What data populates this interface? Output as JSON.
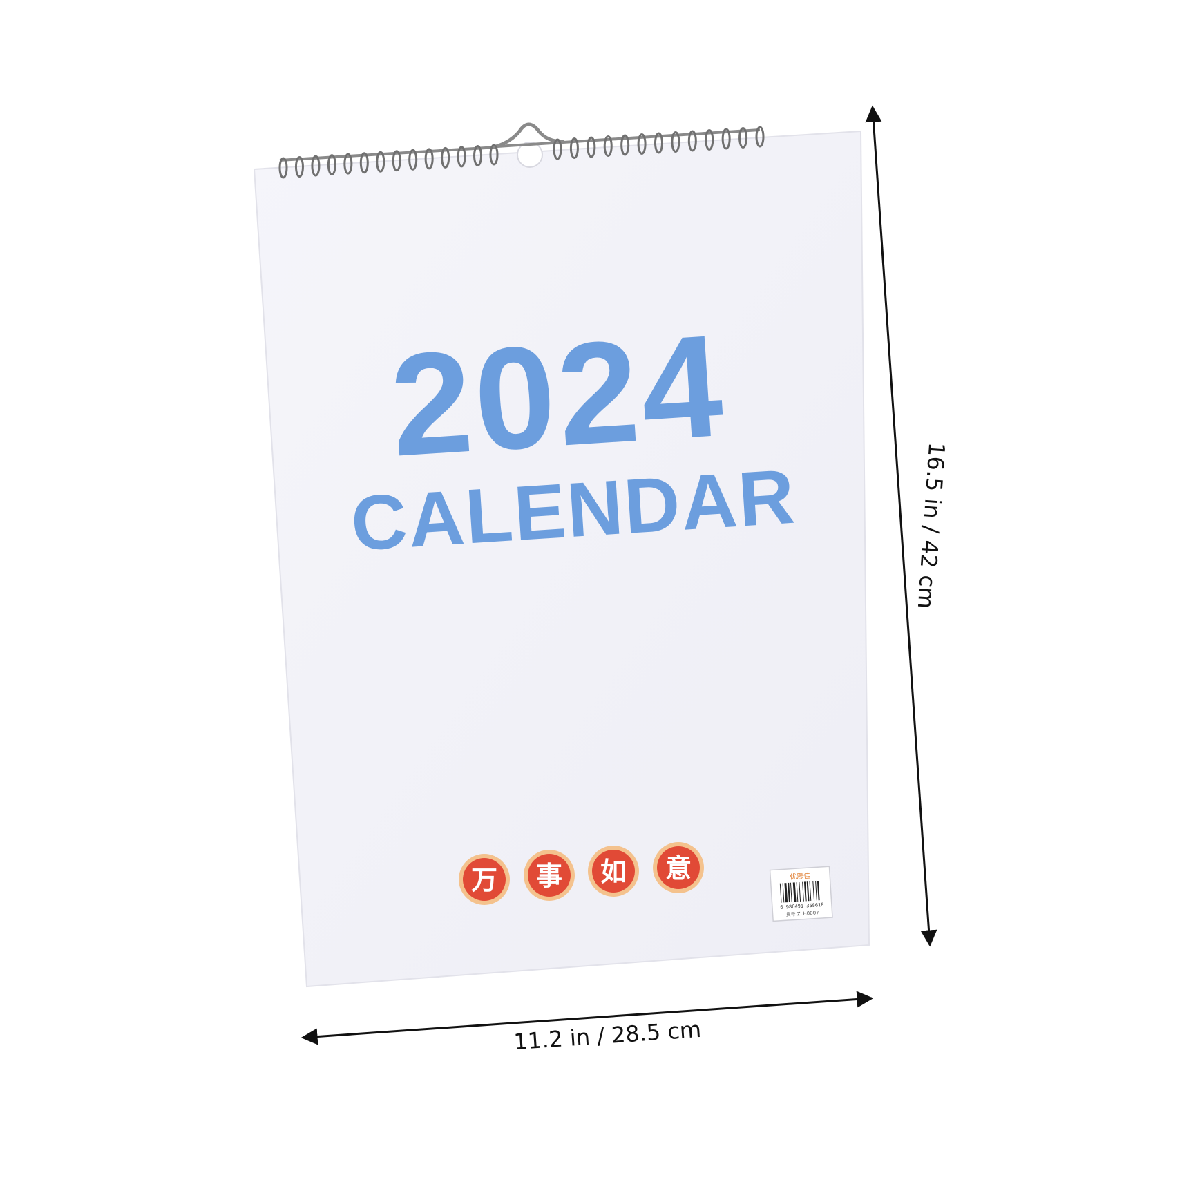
{
  "calendar": {
    "year": "2024",
    "word": "CALENDAR",
    "blessing_chars": [
      "万",
      "事",
      "如",
      "意"
    ],
    "barcode_brand": "优思佳",
    "barcode_number": "6 986491 358618",
    "barcode_sku": "货号 ZLH0007"
  },
  "dimensions": {
    "width_label": "11.2 in / 28.5 cm",
    "height_label": "16.5 in / 42 cm"
  },
  "colors": {
    "title_blue": "#6c9ede",
    "badge_red": "#e14a36",
    "badge_ring": "#f4c28d",
    "paper": "#f1f1f7"
  }
}
